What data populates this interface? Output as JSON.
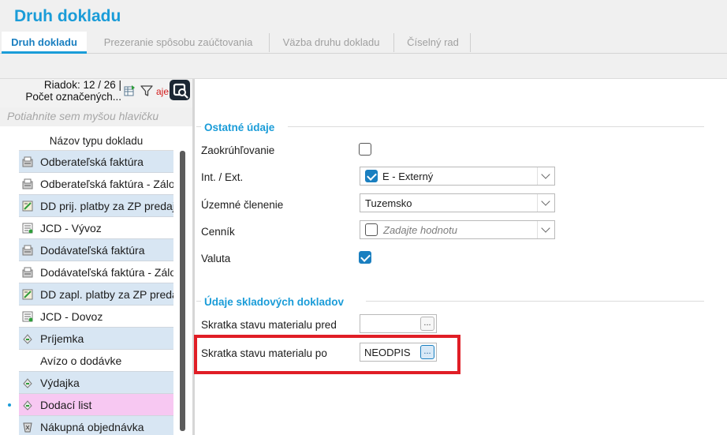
{
  "window": {
    "title": "Druh dokladu"
  },
  "tabs": [
    {
      "label": "Druh dokladu",
      "active": true
    },
    {
      "label": "Prezeranie spôsobu zaúčtovania",
      "active": false
    },
    {
      "label": "Väzba druhu dokladu",
      "active": false
    },
    {
      "label": "Číselný rad",
      "active": false
    }
  ],
  "grid": {
    "row_info": "Riadok: 12 / 26 |",
    "marked_info": "Počet označených...",
    "filter_text": "aje",
    "group_hint": "Potiahnite sem myšou hlavičku",
    "column_header": "Názov typu dokladu",
    "rows": [
      {
        "label": "Odberateľská faktúra",
        "icon": "invoice-icon"
      },
      {
        "label": "Odberateľská faktúra - Zálohová",
        "icon": "invoice-icon"
      },
      {
        "label": "DD prij. platby za ZP predaj",
        "icon": "payment-doc-icon"
      },
      {
        "label": "JCD - Vývoz",
        "icon": "customs-doc-icon"
      },
      {
        "label": "Dodávateľská faktúra",
        "icon": "invoice-icon"
      },
      {
        "label": "Dodávateľská faktúra - Zálohová",
        "icon": "invoice-icon"
      },
      {
        "label": "DD zapl. platby za ZP predaj",
        "icon": "payment-doc-icon"
      },
      {
        "label": "JCD - Dovoz",
        "icon": "customs-doc-icon"
      },
      {
        "label": "Príjemka",
        "icon": "receipt-icon"
      },
      {
        "label": "Avízo o dodávke",
        "icon": ""
      },
      {
        "label": "Výdajka",
        "icon": "receipt-icon"
      },
      {
        "label": "Dodací list",
        "icon": "receipt-icon"
      },
      {
        "label": "Nákupná objednávka",
        "icon": "order-icon"
      }
    ]
  },
  "form": {
    "section1_title": "Ostatné údaje",
    "rounding": {
      "label": "Zaokrúhľovanie",
      "checked": false
    },
    "int_ext": {
      "label": "Int. / Ext.",
      "value": "E - Externý",
      "checked": true
    },
    "territorial": {
      "label": "Územné členenie",
      "value": "Tuzemsko"
    },
    "pricelist": {
      "label": "Cenník",
      "placeholder": "Zadajte hodnotu",
      "checked": false
    },
    "currency": {
      "label": "Valuta",
      "checked": true
    },
    "section2_title": "Údaje skladových dokladov",
    "material_before": {
      "label": "Skratka stavu materialu pred",
      "value": "",
      "button": "..."
    },
    "material_after": {
      "label": "Skratka stavu materialu po",
      "value": "NEODPIS",
      "button": "..."
    }
  },
  "colors": {
    "accent": "#1a9cd8",
    "row_blue": "#d8e6f3",
    "row_pink": "#f7c8f2",
    "highlight": "#e01e26"
  }
}
